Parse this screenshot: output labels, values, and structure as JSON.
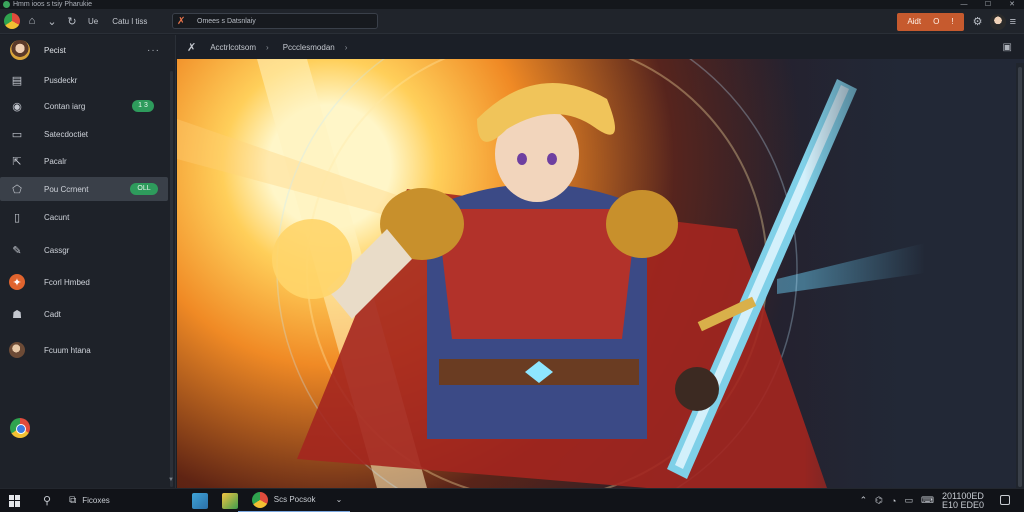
{
  "window": {
    "title": "Hmm ioos s tsiy  Pharukie",
    "controls": [
      "—",
      "☐",
      "✕"
    ]
  },
  "toolbar": {
    "nav_icons": [
      "browser-logo",
      "home-icon",
      "chevron-down-icon",
      "refresh-icon"
    ],
    "tab_label": "Ue",
    "menu_label": "Catu l tiss",
    "address": {
      "text": "Omees s Datsnlaiy"
    },
    "actions": [
      "Aidt",
      "O",
      "!"
    ],
    "right_icons": [
      "gear-icon",
      "avatar",
      "menu-icon"
    ]
  },
  "sidebar": {
    "header": {
      "title": "Pecist",
      "more": "···"
    },
    "items": [
      {
        "label": "Pusdeckr",
        "icon": "file-icon"
      },
      {
        "label": "Contan iarg",
        "icon": "user-icon",
        "badge": "1 3"
      },
      {
        "label": "Satecdoctiet",
        "icon": "folder-icon"
      },
      {
        "label": "Pacalr",
        "icon": "share-icon"
      },
      {
        "label": "Pou Ccrnent",
        "icon": "tag-icon",
        "badge": "OLL",
        "active": true
      },
      {
        "label": "Cacunt",
        "icon": "doc-icon"
      },
      {
        "label": "Cassgr",
        "icon": "edit-icon"
      },
      {
        "label": "Fcorl  Hmbed",
        "icon": "orange-app-icon"
      },
      {
        "label": "Cadt",
        "icon": "robot-icon"
      },
      {
        "label": "Fcuum htana",
        "icon": "photo-avatar"
      }
    ]
  },
  "main": {
    "breadcrumb": [
      {
        "label": "Acctrlcotsom"
      },
      {
        "label": "Pccclesmodan"
      }
    ]
  },
  "taskbar": {
    "search_text": "Ficoxes",
    "active_app_label": "Scs Pocsok",
    "clock": {
      "time": "201100ED",
      "date": "E10 EDE0"
    }
  },
  "colors": {
    "accent_orange": "#c65a2e",
    "badge_green": "#2e9b5c",
    "sidebar_bg": "#1e2229",
    "active_item_bg": "#3a4049"
  }
}
